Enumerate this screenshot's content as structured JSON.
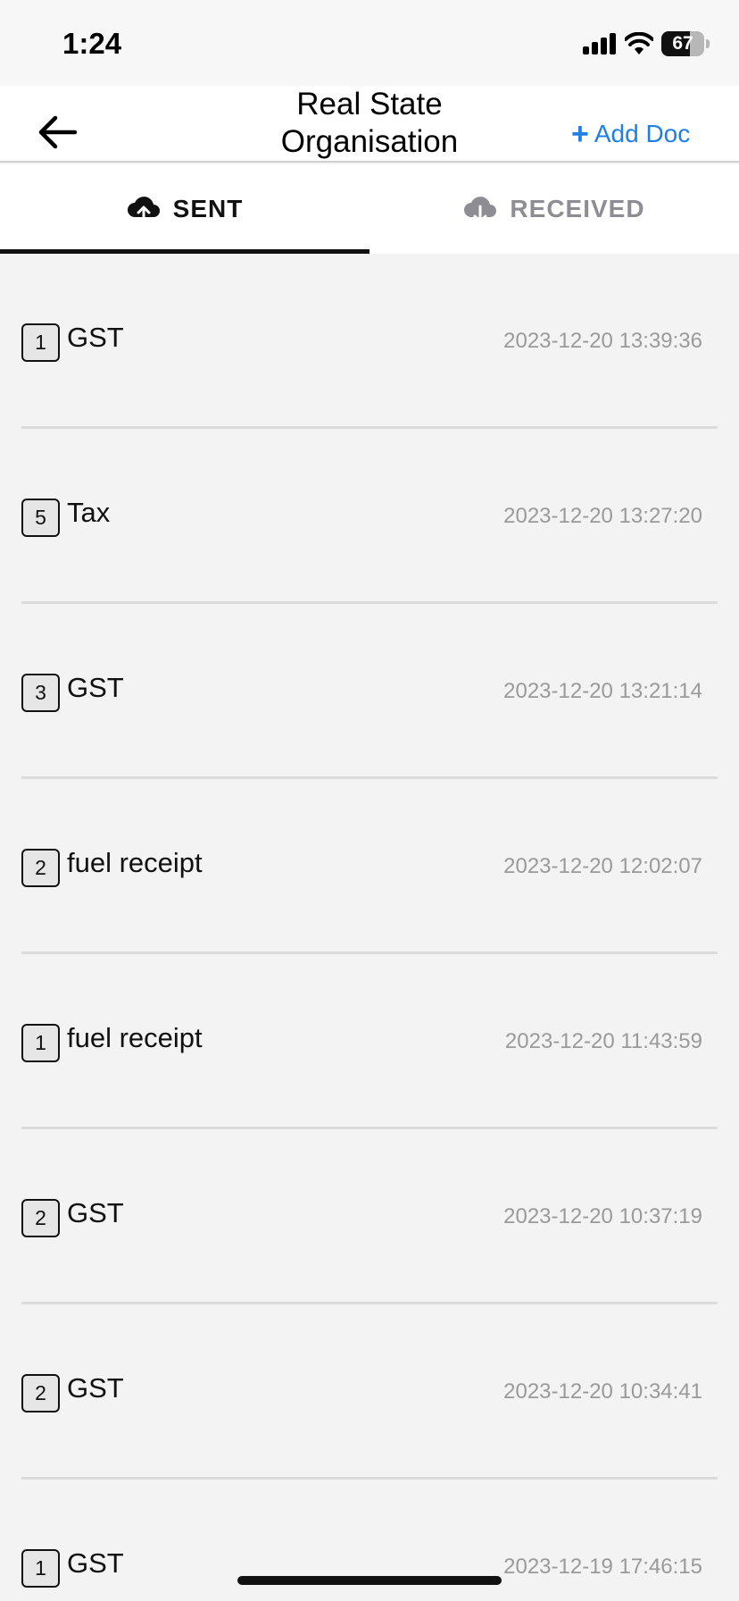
{
  "status_bar": {
    "time": "1:24",
    "battery": "67",
    "battery_level": 0.67
  },
  "nav": {
    "title": "Real State Organisation",
    "back_icon": "arrow-left-icon",
    "add_doc_label": "Add Doc",
    "add_doc_icon": "plus-icon",
    "accent_color": "#1e7fe6"
  },
  "tabs": [
    {
      "label": "SENT",
      "icon": "cloud-upload-icon",
      "active": true
    },
    {
      "label": "RECEIVED",
      "icon": "cloud-download-icon",
      "active": false
    }
  ],
  "documents": [
    {
      "count": "1",
      "name": "GST",
      "timestamp": "2023-12-20 13:39:36"
    },
    {
      "count": "5",
      "name": "Tax",
      "timestamp": "2023-12-20 13:27:20"
    },
    {
      "count": "3",
      "name": "GST",
      "timestamp": "2023-12-20 13:21:14"
    },
    {
      "count": "2",
      "name": "fuel receipt",
      "timestamp": "2023-12-20 12:02:07"
    },
    {
      "count": "1",
      "name": "fuel receipt",
      "timestamp": "2023-12-20 11:43:59"
    },
    {
      "count": "2",
      "name": "GST",
      "timestamp": "2023-12-20 10:37:19"
    },
    {
      "count": "2",
      "name": "GST",
      "timestamp": "2023-12-20 10:34:41"
    },
    {
      "count": "1",
      "name": "GST",
      "timestamp": "2023-12-19 17:46:15"
    }
  ]
}
